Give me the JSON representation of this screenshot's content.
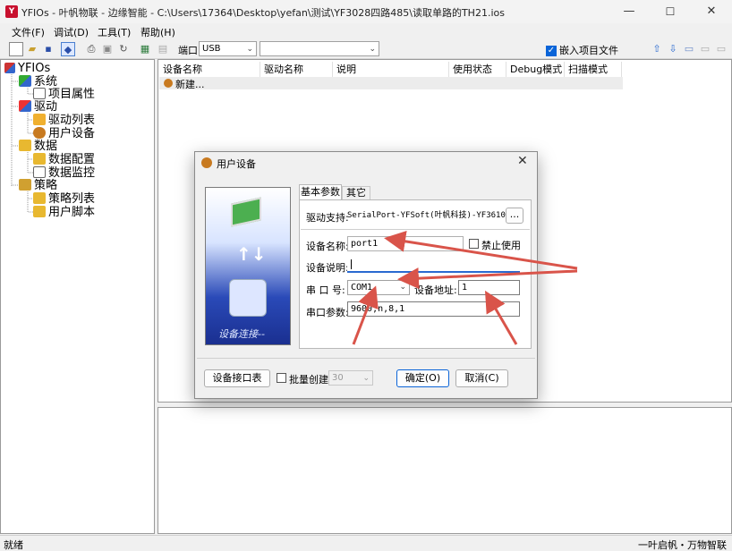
{
  "window": {
    "title": "YFIOs - 叶帆物联 - 边缘智能 - C:\\Users\\17364\\Desktop\\yefan\\测试\\YF3028四路485\\读取单路的TH21.ios",
    "minimize": "—",
    "maximize": "☐",
    "close": "✕",
    "app_icon": "Y"
  },
  "menu": [
    "文件(F)",
    "调试(D)",
    "工具(T)",
    "帮助(H)"
  ],
  "toolbar": {
    "port_label": "端口:",
    "port_value": "USB",
    "second_value": "",
    "embed_label": "嵌入项目文件"
  },
  "tree": {
    "root": "YFIOs",
    "nodes": [
      {
        "label": "系统",
        "children": [
          "项目属性"
        ]
      },
      {
        "label": "驱动",
        "children": [
          "驱动列表",
          "用户设备"
        ]
      },
      {
        "label": "数据",
        "children": [
          "数据配置",
          "数据监控"
        ]
      },
      {
        "label": "策略",
        "children": [
          "策略列表",
          "用户脚本"
        ]
      }
    ]
  },
  "list": {
    "columns": [
      "设备名称",
      "驱动名称",
      "说明",
      "使用状态",
      "Debug模式",
      "扫描模式"
    ],
    "new_row": "新建..."
  },
  "dialog": {
    "title": "用户设备",
    "tabs": [
      "基本参数",
      "其它"
    ],
    "image_caption": "设备连接--",
    "driver_label": "驱动支持:",
    "driver_value": "SerialPort-YFSoft(叶帆科技)-YF3610-",
    "driver_browse": "...",
    "name_label": "设备名称:",
    "name_value": "port1",
    "disable_label": "禁止使用",
    "desc_label": "设备说明:",
    "desc_value": "",
    "port_label": "串 口 号:",
    "port_value": "COM1",
    "addr_label": "设备地址:",
    "addr_value": "1",
    "params_label": "串口参数:",
    "params_value": "9600,n,8,1",
    "interface_button": "设备接口表",
    "batch_label": "批量创建",
    "batch_value": "30",
    "ok_button": "确定(O)",
    "cancel_button": "取消(C)"
  },
  "status": {
    "left": "就绪",
    "right": "一叶启帆・万物智联"
  },
  "colors": {
    "arrow": "#d9544a",
    "accent": "#0a64d8",
    "image_bg": "#1f3fa8"
  }
}
